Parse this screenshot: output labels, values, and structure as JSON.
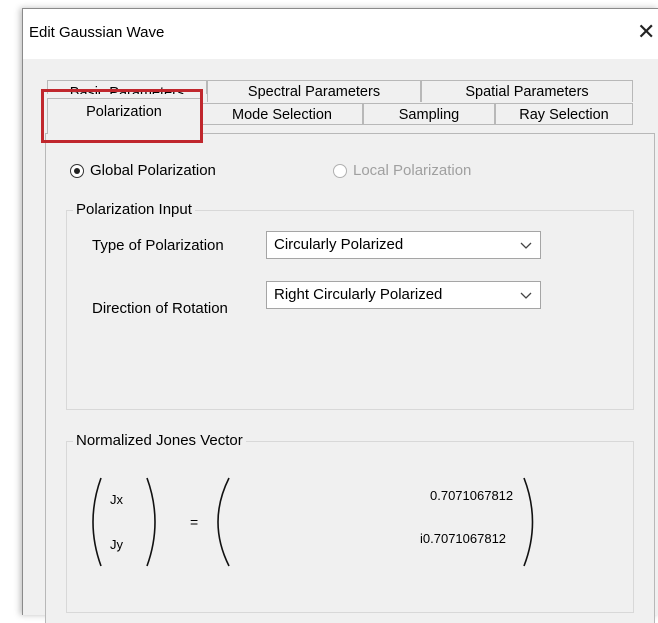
{
  "window": {
    "title": "Edit Gaussian Wave",
    "close_glyph": "✕"
  },
  "tabs": {
    "row1": [
      "Basic Parameters",
      "Spectral Parameters",
      "Spatial Parameters"
    ],
    "row2": [
      "Polarization",
      "Mode Selection",
      "Sampling",
      "Ray Selection"
    ],
    "active": "Polarization"
  },
  "polarization_mode": {
    "global_label": "Global Polarization",
    "local_label": "Local Polarization",
    "selected": "Global Polarization"
  },
  "polarization_input": {
    "group_label": "Polarization Input",
    "type_label": "Type of Polarization",
    "type_value": "Circularly Polarized",
    "direction_label": "Direction of Rotation",
    "direction_value": "Right Circularly Polarized"
  },
  "jones_vector": {
    "group_label": "Normalized Jones Vector",
    "jx_label": "Jx",
    "jy_label": "Jy",
    "equals": "=",
    "jx_value": "0.7071067812",
    "jy_value": "i0.7071067812"
  },
  "colors": {
    "highlight": "#c0272d",
    "window_bg": "#f0f0f0"
  }
}
